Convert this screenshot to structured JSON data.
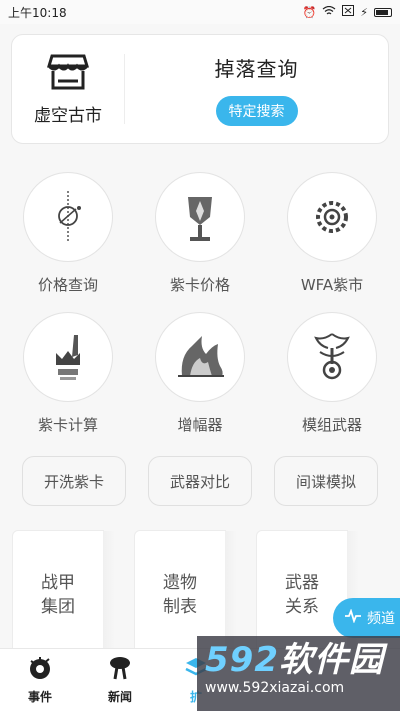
{
  "status_bar": {
    "time": "上午10:18",
    "icons": [
      "alarm-icon",
      "wifi-icon",
      "sim-icon",
      "charging-icon",
      "battery-icon"
    ]
  },
  "top_card": {
    "market_label": "虚空古市",
    "drop_title": "掉落查询",
    "search_button": "特定搜索"
  },
  "grid": [
    {
      "label": "价格查询",
      "icon": "price-query-icon"
    },
    {
      "label": "紫卡价格",
      "icon": "riven-price-icon"
    },
    {
      "label": "WFA紫市",
      "icon": "wfa-market-icon"
    },
    {
      "label": "紫卡计算",
      "icon": "riven-calc-icon"
    },
    {
      "label": "增幅器",
      "icon": "amp-icon"
    },
    {
      "label": "模组武器",
      "icon": "modular-weapon-icon"
    }
  ],
  "pills": [
    "开洗紫卡",
    "武器对比",
    "间谍模拟"
  ],
  "tall_cards": [
    {
      "line1": "战甲",
      "line2": "集团"
    },
    {
      "line1": "遗物",
      "line2": "制表"
    },
    {
      "line1": "武器",
      "line2": "关系"
    }
  ],
  "channel_button": "频道",
  "bottom_nav": [
    {
      "label": "事件",
      "icon": "event-icon"
    },
    {
      "label": "新闻",
      "icon": "news-icon"
    },
    {
      "label": "扩",
      "icon": "extension-icon"
    }
  ],
  "watermark": {
    "logo_num": "592",
    "logo_text": "软件园",
    "url": "www.592xiazai.com"
  },
  "colors": {
    "accent": "#3ab6ec",
    "background": "#f7f7f7"
  }
}
